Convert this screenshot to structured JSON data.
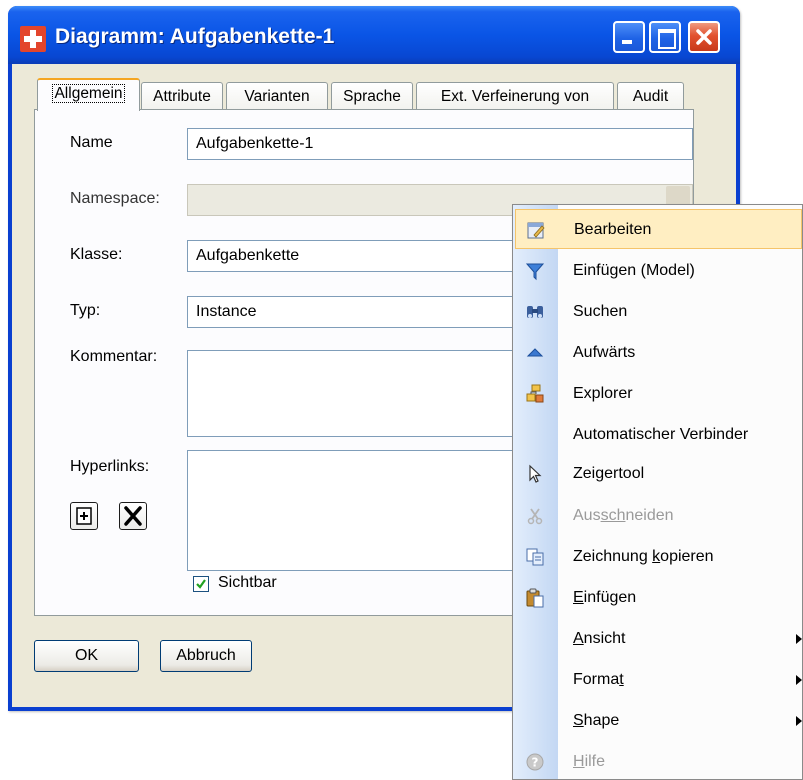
{
  "window": {
    "title": "Diagramm: Aufgabenkette-1"
  },
  "tabs": [
    {
      "label": "Allgemein",
      "active": true
    },
    {
      "label": "Attribute"
    },
    {
      "label": "Varianten"
    },
    {
      "label": "Sprache"
    },
    {
      "label": "Ext. Verfeinerung von"
    },
    {
      "label": "Audit"
    }
  ],
  "form": {
    "name_label": "Name",
    "name_value": "Aufgabenkette-1",
    "namespace_label": "Namespace:",
    "namespace_value": "",
    "klasse_label": "Klasse:",
    "klasse_value": "Aufgabenkette",
    "typ_label": "Typ:",
    "typ_value": "Instance",
    "kommentar_label": "Kommentar:",
    "hyperlinks_label": "Hyperlinks:",
    "sichtbar_label": "Sichtbar",
    "sichtbar_checked": true
  },
  "buttons": {
    "ok": "OK",
    "abbruch": "Abbruch"
  },
  "context_menu": {
    "items": [
      {
        "label": "Bearbeiten",
        "icon": "edit-icon",
        "highlighted": true
      },
      {
        "label": "Einfügen (Model)",
        "icon": "filter-icon"
      },
      {
        "label": "Suchen",
        "icon": "binoculars-icon"
      },
      {
        "label": "Aufwärts",
        "icon": "up-arrow-icon"
      },
      {
        "label": "Explorer",
        "icon": "explorer-icon"
      },
      {
        "label": "Automatischer Verbinder",
        "icon": ""
      },
      {
        "label": "Zeigertool",
        "icon": "pointer-icon"
      },
      {
        "label": "Ausschneiden",
        "icon": "scissors-icon",
        "disabled": true,
        "mnemonic": "sch"
      },
      {
        "label": "Zeichnung kopieren",
        "icon": "copy-icon",
        "mnemonic": "k"
      },
      {
        "label": "Einfügen",
        "icon": "paste-icon",
        "mnemonic": "E"
      },
      {
        "label": "Ansicht",
        "icon": "",
        "submenu": true,
        "mnemonic": "A"
      },
      {
        "label": "Format",
        "icon": "",
        "submenu": true,
        "mnemonic": "t"
      },
      {
        "label": "Shape",
        "icon": "",
        "submenu": true,
        "mnemonic": "S"
      },
      {
        "label": "Hilfe",
        "icon": "help-icon",
        "disabled": true,
        "mnemonic": "H"
      }
    ]
  }
}
